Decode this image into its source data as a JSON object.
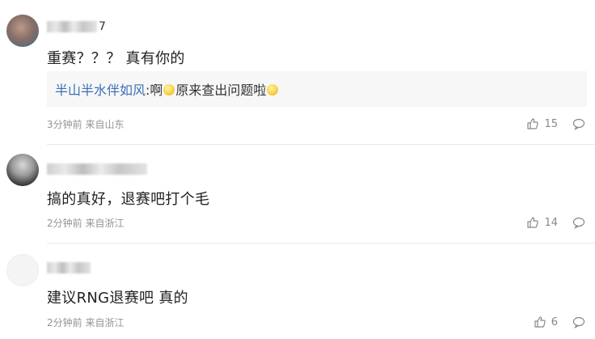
{
  "comments": [
    {
      "username_suffix": "7",
      "text": "重赛？？？ 真有你的",
      "reply": {
        "name": "半山半水伴如风",
        "separator": ":",
        "part1": "啊",
        "part2": "原来查出问题啦"
      },
      "time": "3分钟前",
      "location": "来自山东",
      "likes": "15"
    },
    {
      "username_suffix": "",
      "text": "搞的真好，退赛吧打个毛",
      "time": "2分钟前",
      "location": "来自浙江",
      "likes": "14"
    },
    {
      "username_suffix": "",
      "text": "建议RNG退赛吧 真的",
      "time": "2分钟前",
      "location": "来自浙江",
      "likes": "6"
    }
  ],
  "colors": {
    "reply_name": "#3b6fb6",
    "meta_text": "#939393",
    "divider": "#e8e8e8",
    "reply_bg": "#f7f7f7"
  },
  "icons": {
    "like": "thumbs-up-icon",
    "reply": "chat-bubble-icon",
    "emoji": "smiley-emoji-icon"
  }
}
